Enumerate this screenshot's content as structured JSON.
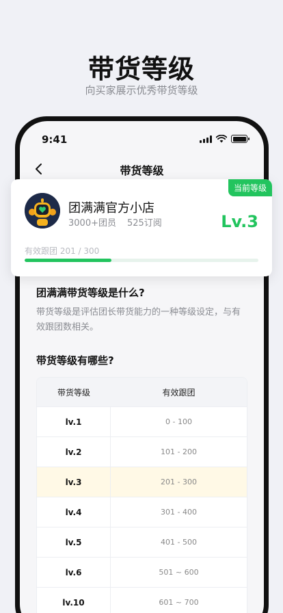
{
  "hero": {
    "title": "带货等级",
    "subtitle": "向买家展示优秀带货等级"
  },
  "status_bar": {
    "time": "9:41"
  },
  "nav": {
    "title": "带货等级",
    "back_icon": "chevron-left-icon"
  },
  "card": {
    "badge": "当前等级",
    "shop_name": "团满满官方小店",
    "members": "3000+团员",
    "subscriptions": "525订阅",
    "level": "Lv.3",
    "progress_label": "有效跟团 201 / 300",
    "progress_fraction": 0.37,
    "accent_color": "#22c45e"
  },
  "info": {
    "q1": "团满满带货等级是什么?",
    "a1": "带货等级是评估团长带货能力的一种等级设定，与有效跟团数相关。",
    "q2": "带货等级有哪些?"
  },
  "table": {
    "headers": [
      "带货等级",
      "有效跟团"
    ],
    "rows": [
      {
        "level": "lv.1",
        "range": "0 - 100"
      },
      {
        "level": "lv.2",
        "range": "101 - 200"
      },
      {
        "level": "lv.3",
        "range": "201 - 300",
        "current": true
      },
      {
        "level": "lv.4",
        "range": "301 - 400"
      },
      {
        "level": "lv.5",
        "range": "401 - 500"
      },
      {
        "level": "lv.6",
        "range": "501 ~ 600"
      },
      {
        "level": "lv.10",
        "range": "601 ~ 700"
      }
    ]
  }
}
